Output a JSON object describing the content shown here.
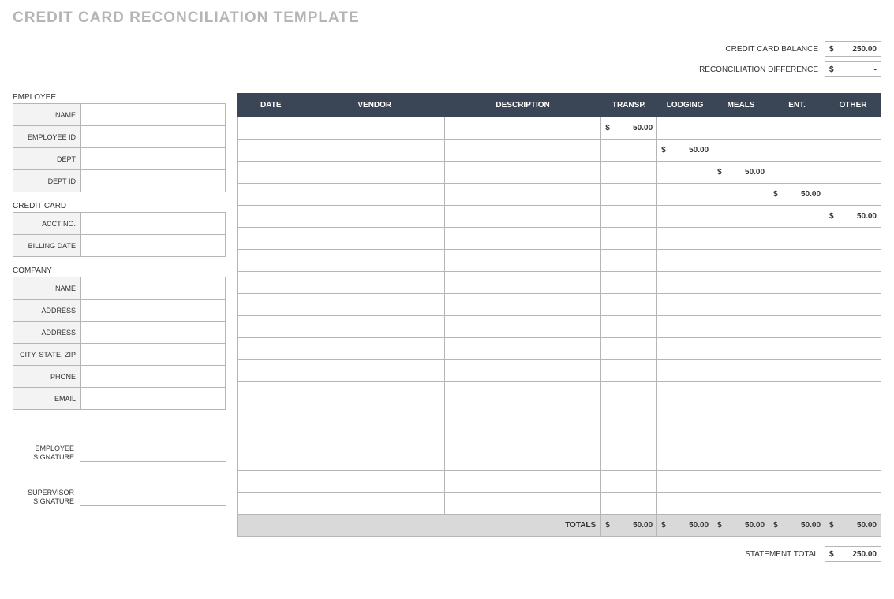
{
  "title": "CREDIT CARD RECONCILIATION TEMPLATE",
  "summary": {
    "balance_label": "CREDIT CARD BALANCE",
    "balance_value": "250.00",
    "diff_label": "RECONCILIATION DIFFERENCE",
    "diff_value": "-"
  },
  "sections": {
    "employee": {
      "heading": "EMPLOYEE",
      "rows": [
        "NAME",
        "EMPLOYEE ID",
        "DEPT",
        "DEPT ID"
      ]
    },
    "credit_card": {
      "heading": "CREDIT CARD",
      "rows": [
        "ACCT NO.",
        "BILLING DATE"
      ]
    },
    "company": {
      "heading": "COMPANY",
      "rows": [
        "NAME",
        "ADDRESS",
        "ADDRESS",
        "CITY, STATE, ZIP",
        "PHONE",
        "EMAIL"
      ]
    }
  },
  "signatures": {
    "employee": "EMPLOYEE SIGNATURE",
    "supervisor": "SUPERVISOR SIGNATURE"
  },
  "table": {
    "headers": [
      "DATE",
      "VENDOR",
      "DESCRIPTION",
      "TRANSP.",
      "LODGING",
      "MEALS",
      "ENT.",
      "OTHER"
    ],
    "rows": [
      {
        "transp": "50.00"
      },
      {
        "lodging": "50.00"
      },
      {
        "meals": "50.00"
      },
      {
        "ent": "50.00"
      },
      {
        "other": "50.00"
      },
      {},
      {},
      {},
      {},
      {},
      {},
      {},
      {},
      {},
      {},
      {},
      {},
      {}
    ],
    "totals_label": "TOTALS",
    "totals": {
      "transp": "50.00",
      "lodging": "50.00",
      "meals": "50.00",
      "ent": "50.00",
      "other": "50.00"
    }
  },
  "statement_total": {
    "label": "STATEMENT TOTAL",
    "value": "250.00"
  },
  "currency": "$"
}
